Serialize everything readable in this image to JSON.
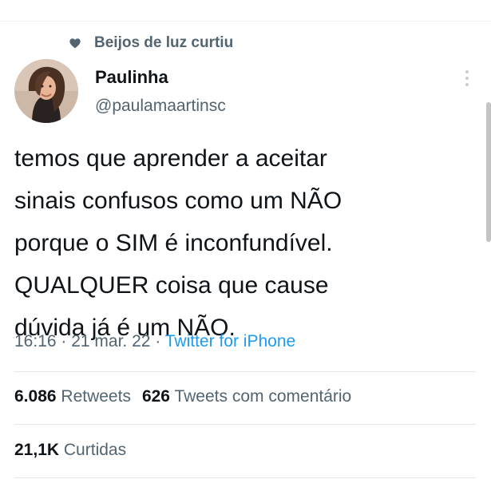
{
  "context": {
    "icon": "heart-icon",
    "text": "Beijos de luz curtiu"
  },
  "author": {
    "display_name": "Paulinha",
    "handle": "@paulamaartinsc",
    "avatar": "profile-photo"
  },
  "tweet": {
    "lines": [
      "temos que aprender a aceitar",
      "sinais confusos como um NÃO",
      "porque o SIM é inconfundível.",
      "QUALQUER coisa que cause",
      "dúvida já é um NÃO."
    ],
    "time": "16:16",
    "sep1": " · ",
    "date": "21 mar. 22",
    "sep2": " · ",
    "source": "Twitter for iPhone"
  },
  "stats": {
    "retweets_count": "6.086",
    "retweets_label": "Retweets",
    "quotes_count": "626",
    "quotes_label": "Tweets com comentário",
    "likes_count": "21,1K",
    "likes_label": "Curtidas"
  },
  "colors": {
    "text_primary": "#0f1419",
    "text_secondary": "#536471",
    "link": "#1d9bf0"
  }
}
